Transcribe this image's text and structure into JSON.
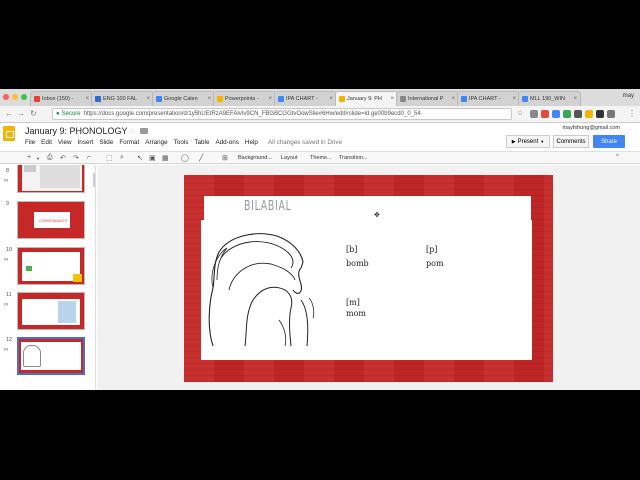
{
  "browser": {
    "tabs": [
      {
        "label": "Inbox (150) - ",
        "favicon_color": "#db4437"
      },
      {
        "label": "ENG 100 FAL",
        "favicon_color": "#2c6ecb"
      },
      {
        "label": "Google Calen",
        "favicon_color": "#4285f4"
      },
      {
        "label": "Powerpoints -",
        "favicon_color": "#f4b400"
      },
      {
        "label": "IPA CHART - ",
        "favicon_color": "#4285f4"
      },
      {
        "label": "January 9: PH",
        "favicon_color": "#f4b400"
      },
      {
        "label": "International P",
        "favicon_color": "#888888"
      },
      {
        "label": "IPA CHART - ",
        "favicon_color": "#4285f4"
      },
      {
        "label": "MLL 190_WIN",
        "favicon_color": "#4285f4"
      }
    ],
    "profile_name": "may",
    "secure_label": "Secure",
    "url": "https://docs.google.com/presentation/d/1y5hUEtRzA9EFAlvIv9CN_FBGBCGGtvOowSlie#6Hw/edit#slide=id.ge00b9ecd0_0_54"
  },
  "docs": {
    "title": "January 9: PHONOLOGY",
    "menu": [
      "File",
      "Edit",
      "View",
      "Insert",
      "Slide",
      "Format",
      "Arrange",
      "Tools",
      "Table",
      "Add-ons",
      "Help"
    ],
    "saved_status": "All changes saved in Drive",
    "account_email": "mayfshung@gmail.com",
    "present_label": "Present",
    "comments_label": "Comments",
    "share_label": "Share",
    "accent": "#4285f4",
    "brand": "#f4b400"
  },
  "toolbar": {
    "background_label": "Background...",
    "layout_label": "Layout",
    "theme_label": "Theme...",
    "transition_label": "Transition..."
  },
  "filmstrip": {
    "slides": [
      {
        "number": "8"
      },
      {
        "number": "9",
        "label": "CONSONANTS"
      },
      {
        "number": "10"
      },
      {
        "number": "11"
      },
      {
        "number": "12"
      }
    ]
  },
  "slide": {
    "title": "BILABIAL",
    "background_color": "#c62828",
    "sounds": [
      {
        "ipa": "[b]",
        "word": "bomb"
      },
      {
        "ipa": "[p]",
        "word": "pom"
      },
      {
        "ipa": "[m]",
        "word": "mom"
      }
    ]
  }
}
